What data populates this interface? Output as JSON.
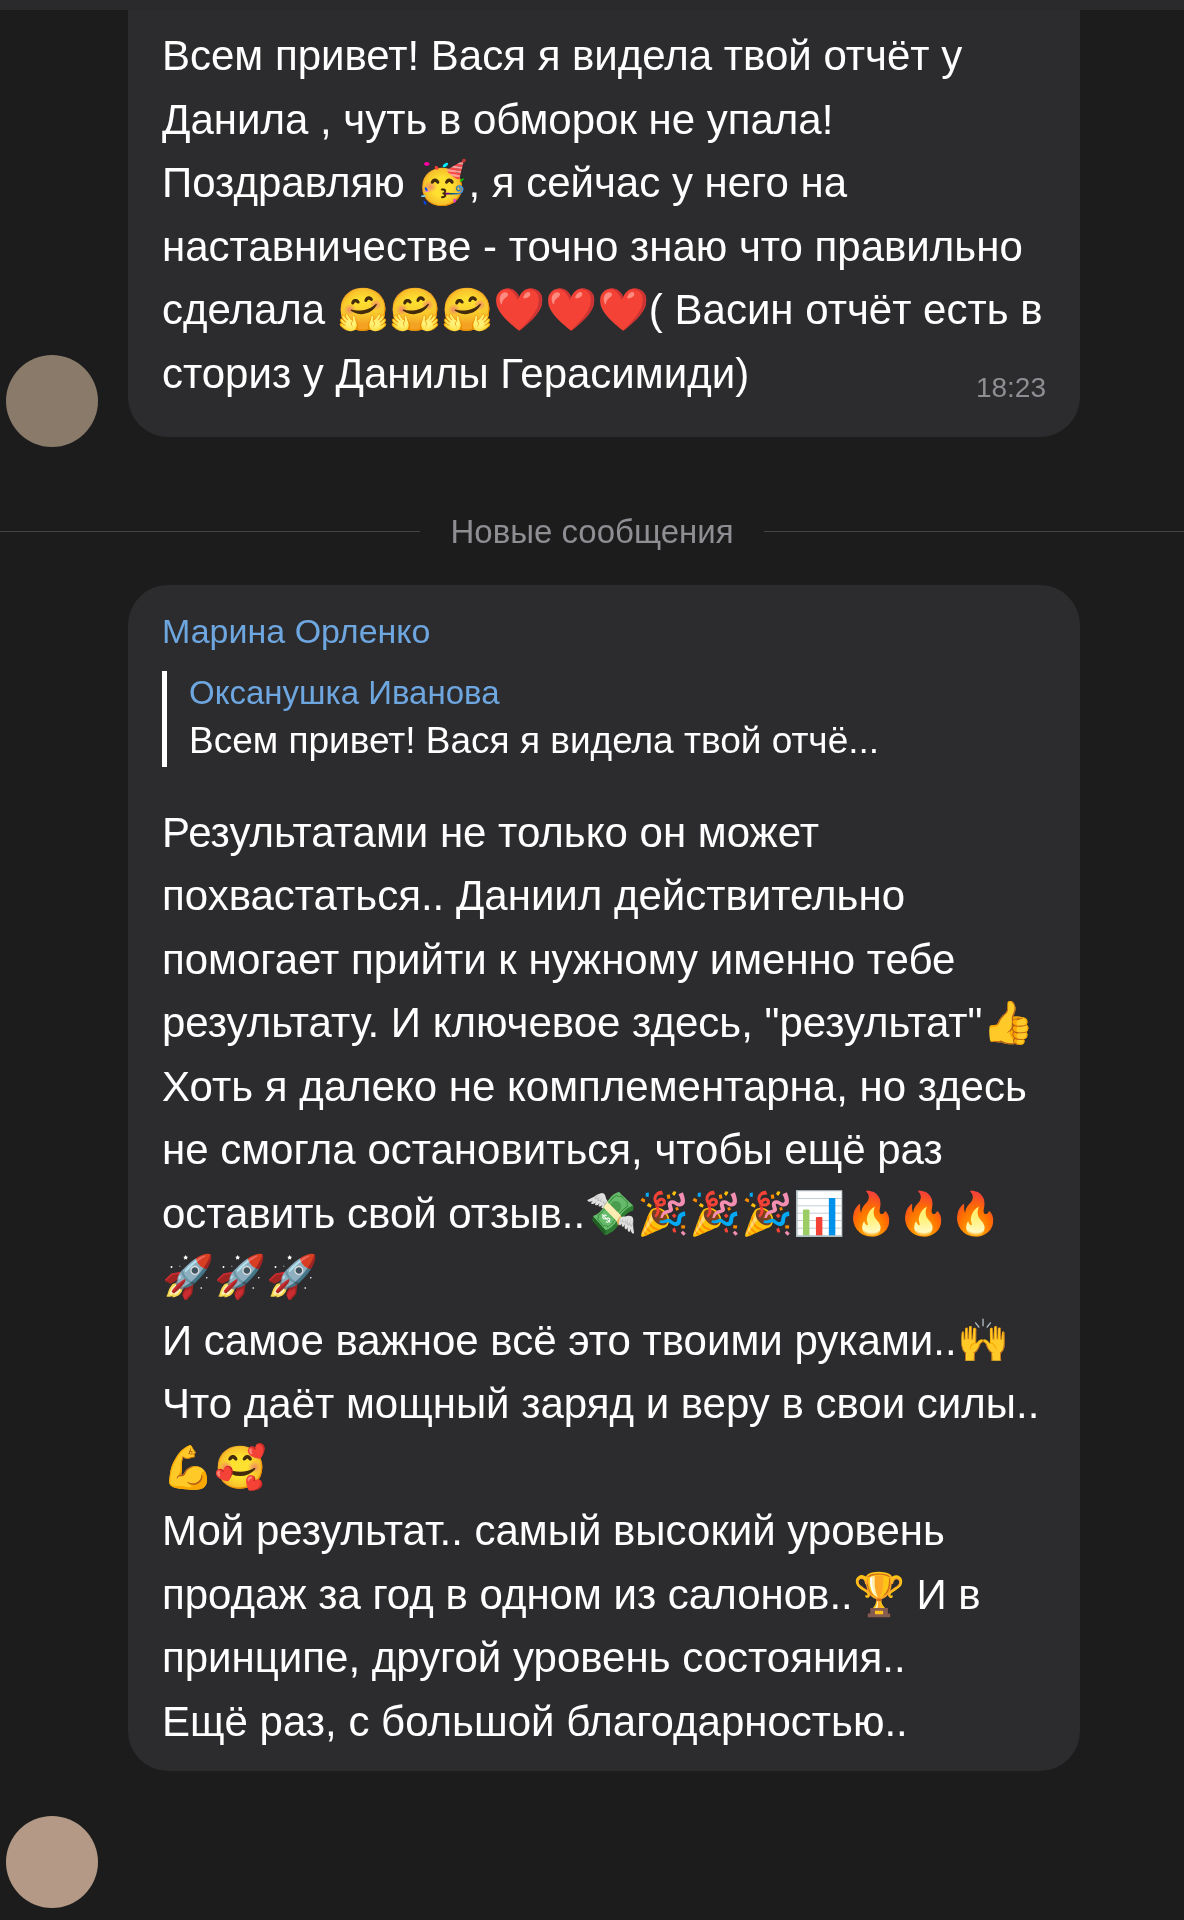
{
  "messages": [
    {
      "kind": "plain",
      "text": "Всем привет! Вася я видела твой отчёт у Данила , чуть в обморок не упала! Поздравляю 🥳, я сейчас у него на наставничестве - точно знаю что правильно сделала 🤗🤗🤗❤️❤️❤️( Васин отчёт есть в сториз у Данилы Герасимиди)",
      "time": "18:23"
    },
    {
      "kind": "divider",
      "text": "Новые сообщения"
    },
    {
      "kind": "reply",
      "sender": "Марина Орленко",
      "reply_to": {
        "sender": "Оксанушка Иванова",
        "text": "Всем привет! Вася я видела твой отчё..."
      },
      "paragraphs": [
        "Результатами не только он может похвастаться.. Даниил действительно помогает прийти к нужному именно тебе результату. И ключевое здесь, \"результат\"👍",
        "Хоть я далеко не комплементарна, но здесь не смогла остановиться, чтобы ещё раз оставить свой отзыв..💸🎉🎉🎉📊🔥🔥🔥🚀🚀🚀",
        "И самое важное всё это твоими руками..🙌 Что даёт мощный заряд и веру в свои силы..💪🥰",
        "Мой результат.. самый высокий уровень продаж за год в одном из салонов..🏆 И в принципе, другой уровень состояния..",
        "Ещё раз, с большой благодарностью.."
      ]
    }
  ]
}
